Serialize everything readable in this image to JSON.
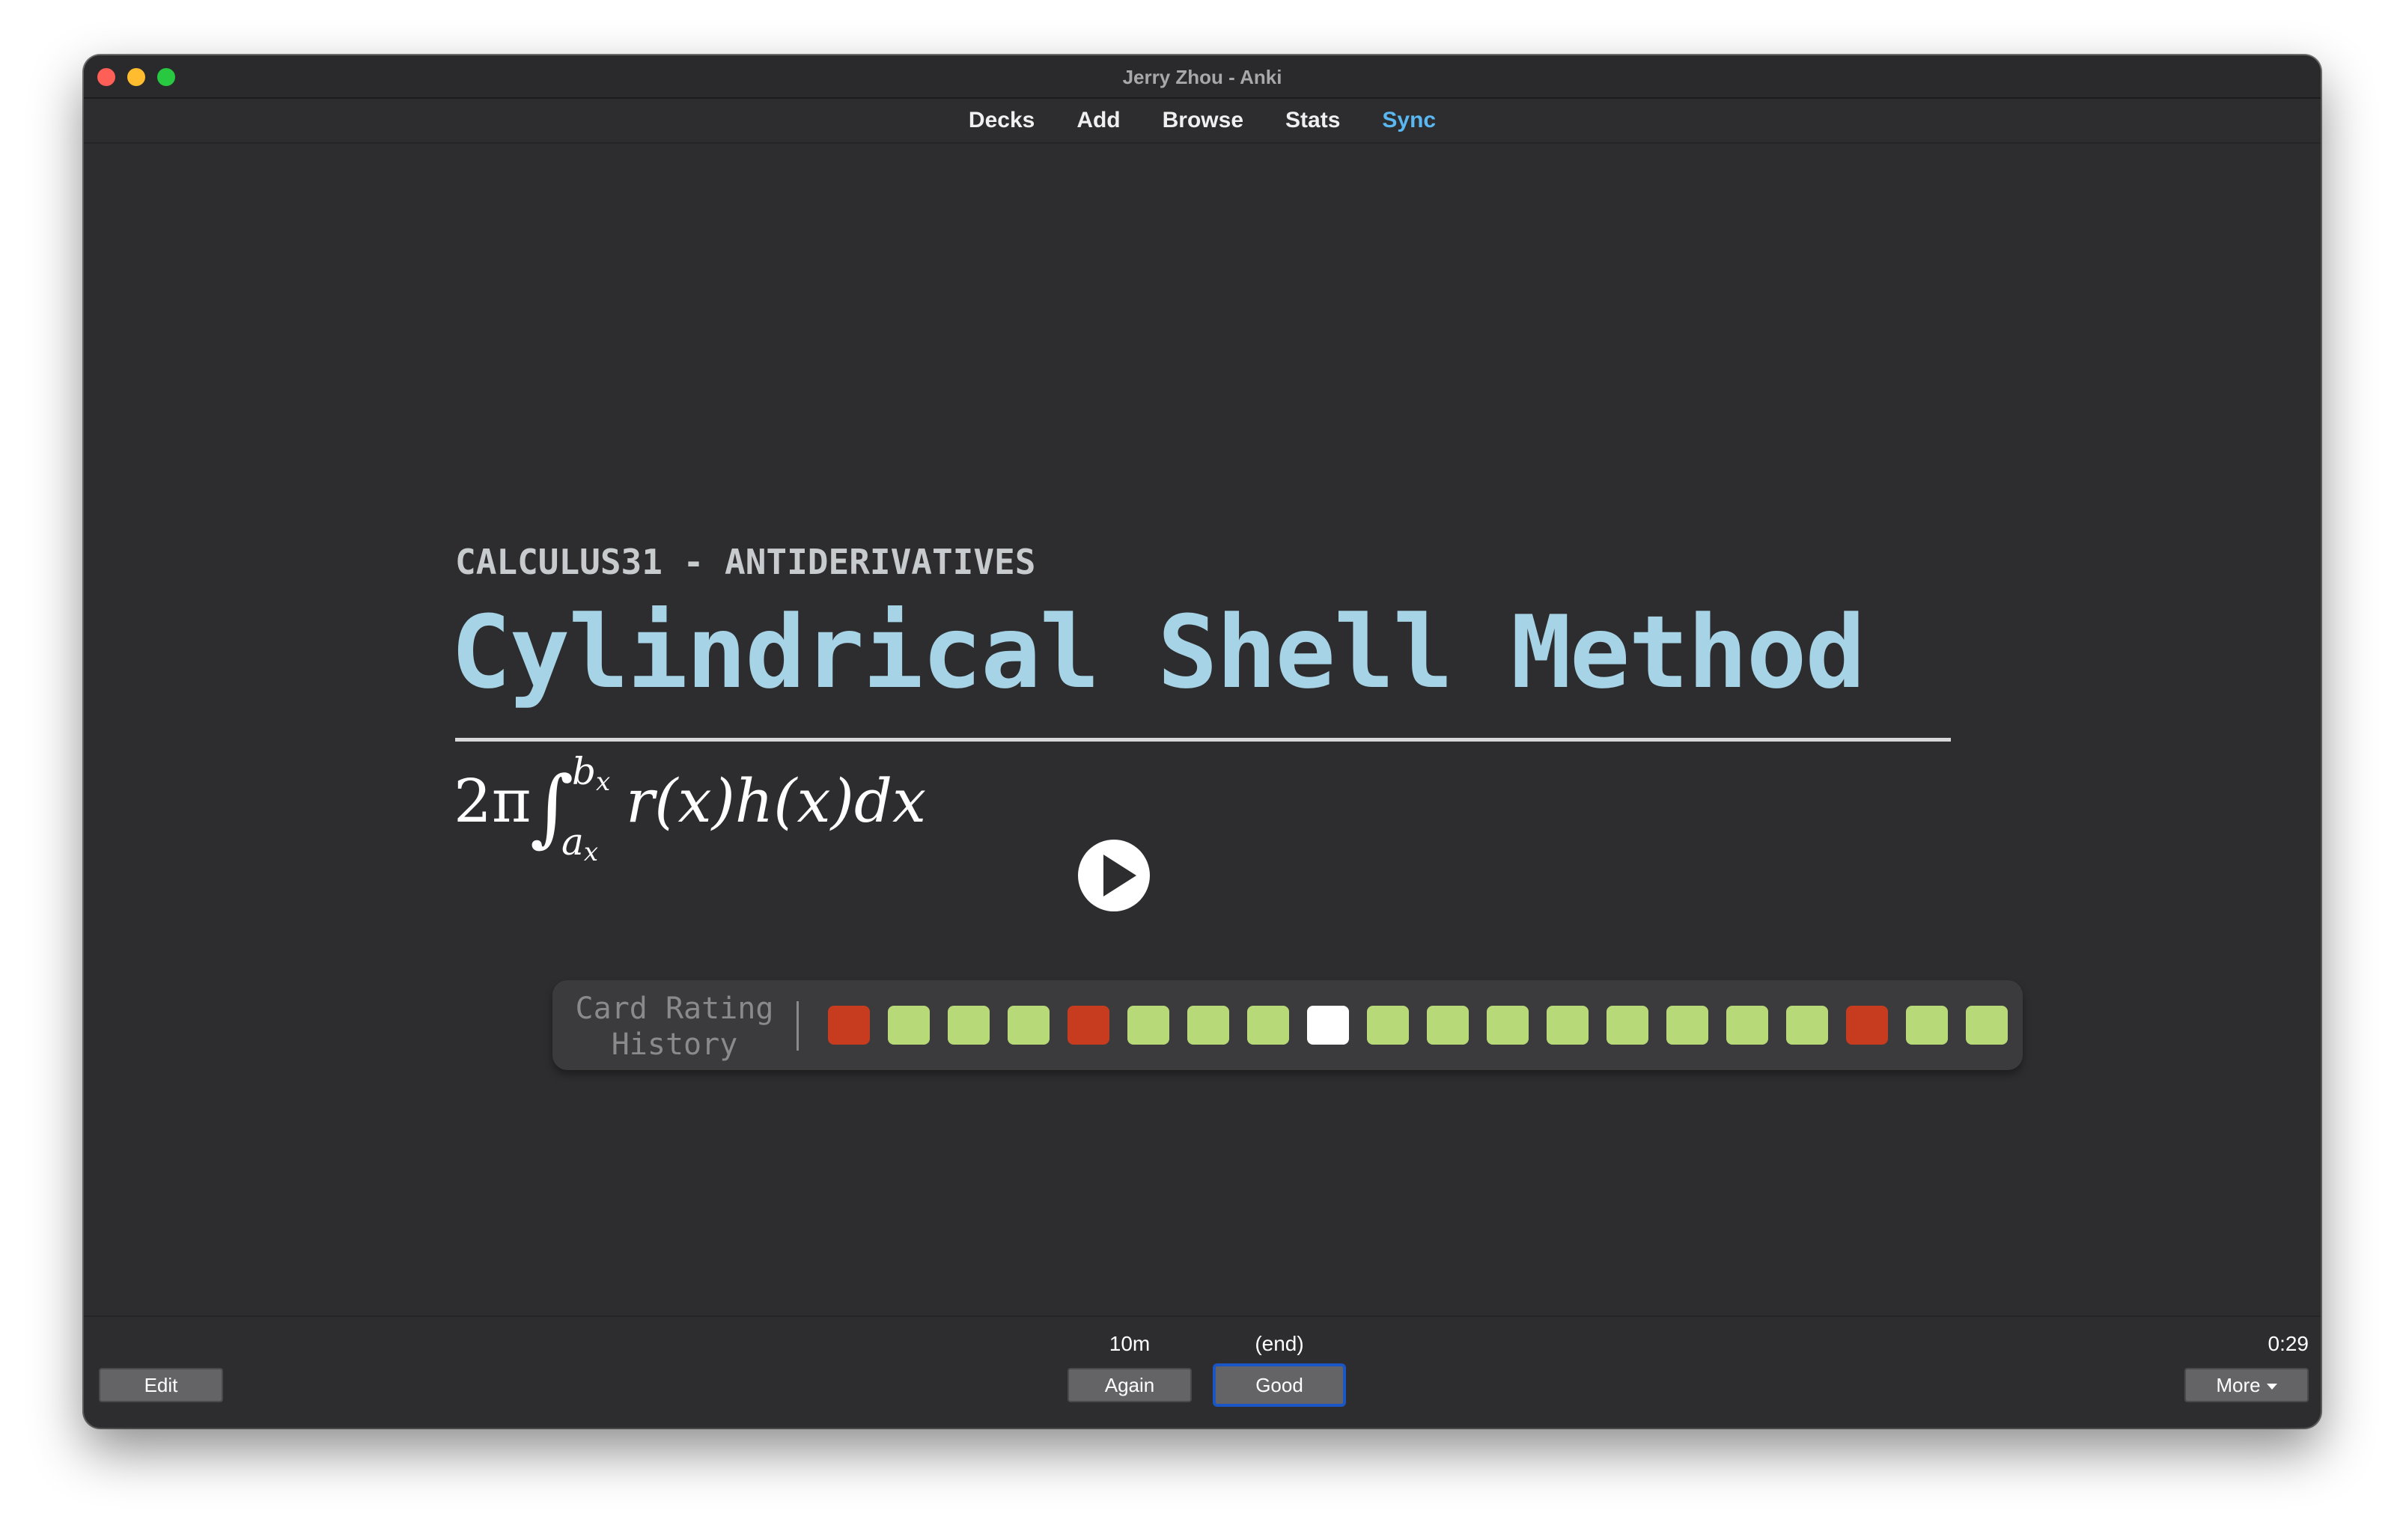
{
  "window": {
    "title": "Jerry Zhou - Anki"
  },
  "toolbar": {
    "items": [
      {
        "label": "Decks"
      },
      {
        "label": "Add"
      },
      {
        "label": "Browse"
      },
      {
        "label": "Stats"
      },
      {
        "label": "Sync",
        "color": "#5ab7f2"
      }
    ]
  },
  "card": {
    "deck": "CALCULUS31 - ANTIDERIVATIVES",
    "title": "Cylindrical Shell Method",
    "formula": {
      "lead": "2π",
      "integral": "∫",
      "upper": "b",
      "upper_sub": "x",
      "lower": "a",
      "lower_sub": "x",
      "body": "r(x)h(x)dx"
    },
    "play_icon": "play-icon"
  },
  "history": {
    "label": "Card Rating History",
    "colors": {
      "again": "#c73b1e",
      "good": "#b8d978",
      "current": "#ffffff"
    },
    "ratings": [
      "again",
      "good",
      "good",
      "good",
      "again",
      "good",
      "good",
      "good",
      "current",
      "good",
      "good",
      "good",
      "good",
      "good",
      "good",
      "good",
      "good",
      "again",
      "good",
      "good"
    ]
  },
  "bottom": {
    "edit_label": "Edit",
    "again_label": "Again",
    "again_interval": "10m",
    "good_label": "Good",
    "good_interval": "(end)",
    "more_label": "More",
    "timer": "0:29"
  }
}
